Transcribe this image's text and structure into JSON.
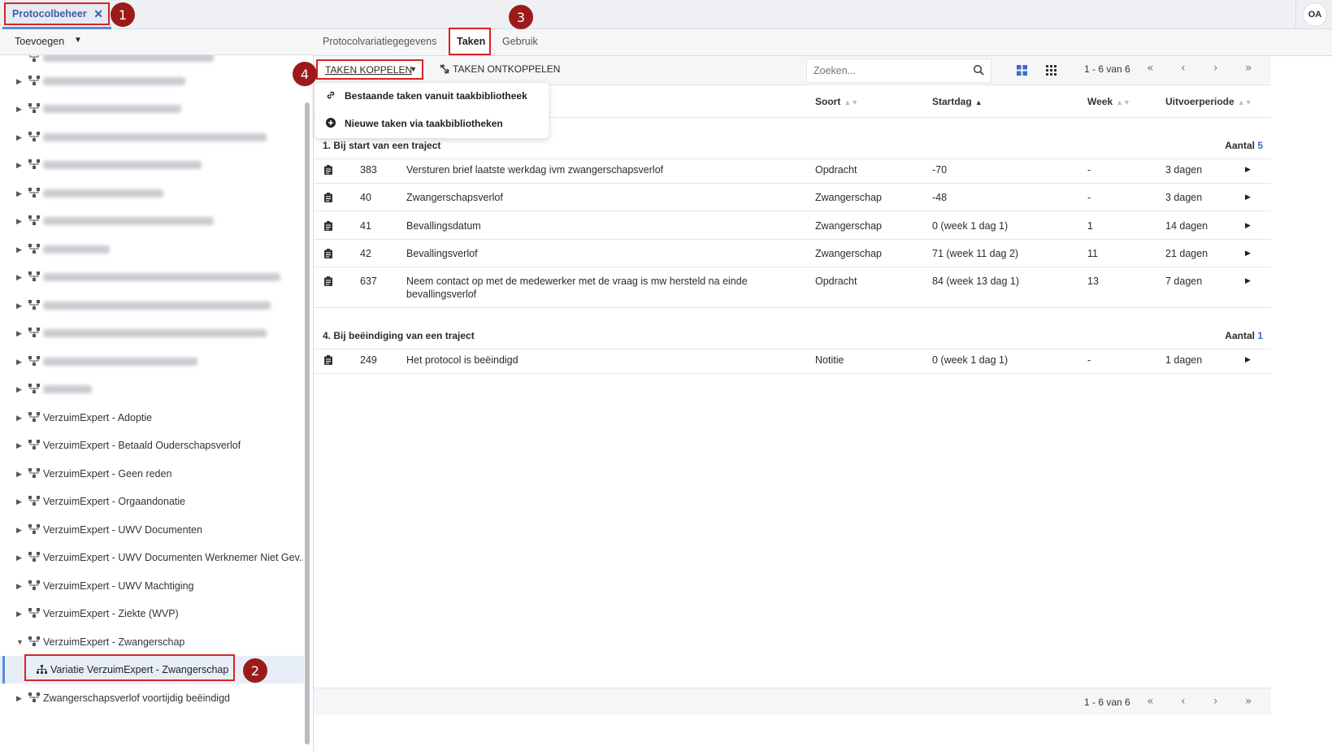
{
  "app_tab": {
    "label": "Protocolbeheer",
    "close": "✕"
  },
  "markers": [
    "1",
    "2",
    "3",
    "4"
  ],
  "user": {
    "initials": "OA"
  },
  "left": {
    "add_label": "Toevoegen",
    "tree": [
      {
        "label": "VerzuimExpert - Adoptie"
      },
      {
        "label": "VerzuimExpert - Betaald Ouderschapsverlof"
      },
      {
        "label": "VerzuimExpert - Geen reden"
      },
      {
        "label": "VerzuimExpert - Orgaandonatie"
      },
      {
        "label": "VerzuimExpert - UWV Documenten"
      },
      {
        "label": "VerzuimExpert - UWV Documenten Werknemer Niet Gev..."
      },
      {
        "label": "VerzuimExpert - UWV Machtiging"
      },
      {
        "label": "VerzuimExpert - Ziekte (WVP)"
      },
      {
        "label": "VerzuimExpert - Zwangerschap"
      },
      {
        "label": "Variatie VerzuimExpert - Zwangerschap"
      },
      {
        "label": "Zwangerschapsverlof voortijdig beëindigd"
      }
    ]
  },
  "tabs": {
    "gegevens": "Protocolvariatiegegevens",
    "taken": "Taken",
    "gebruik": "Gebruik"
  },
  "toolbar": {
    "koppelen": "TAKEN KOPPELEN",
    "ontkoppelen": "TAKEN ONTKOPPELEN",
    "search_placeholder": "Zoeken...",
    "pager": "1 - 6 van 6"
  },
  "dropdown": {
    "existing": "Bestaande taken vanuit taakbibliotheek",
    "new": "Nieuwe taken via taakbibliotheken"
  },
  "columns": {
    "soort": "Soort",
    "startdag": "Startdag",
    "week": "Week",
    "uitvoerperiode": "Uitvoerperiode"
  },
  "groups": [
    {
      "title": "1. Bij start van een traject",
      "count_label": "Aantal",
      "count": "5",
      "rows": [
        {
          "id": "383",
          "name": "Versturen brief laatste werkdag ivm zwangerschapsverlof",
          "soort": "Opdracht",
          "startdag": "-70",
          "week": "-",
          "periode": "3 dagen"
        },
        {
          "id": "40",
          "name": "Zwangerschapsverlof",
          "soort": "Zwangerschap",
          "startdag": "-48",
          "week": "-",
          "periode": "3 dagen"
        },
        {
          "id": "41",
          "name": "Bevallingsdatum",
          "soort": "Zwangerschap",
          "startdag": "0 (week 1 dag 1)",
          "week": "1",
          "periode": "14 dagen"
        },
        {
          "id": "42",
          "name": "Bevallingsverlof",
          "soort": "Zwangerschap",
          "startdag": "71 (week 11 dag 2)",
          "week": "11",
          "periode": "21 dagen"
        },
        {
          "id": "637",
          "name": "Neem contact op met de medewerker met de vraag is mw hersteld na einde bevallingsverlof",
          "soort": "Opdracht",
          "startdag": "84 (week 13 dag 1)",
          "week": "13",
          "periode": "7 dagen"
        }
      ]
    },
    {
      "title": "4. Bij beëindiging van een traject",
      "count_label": "Aantal",
      "count": "1",
      "rows": [
        {
          "id": "249",
          "name": "Het protocol is beëindigd",
          "soort": "Notitie",
          "startdag": "0 (week 1 dag 1)",
          "week": "-",
          "periode": "1 dagen"
        }
      ]
    }
  ],
  "footer": {
    "pager": "1 - 6 van 6"
  },
  "icons": {
    "close": "close-icon",
    "caret": "caret-down-icon",
    "tree_node": "hierarchy-icon",
    "variation": "sitemap-icon",
    "link": "link-icon",
    "unlink": "unlink-icon",
    "plus": "plus-circle-icon",
    "search": "search-icon",
    "view_large": "grid-large-icon",
    "view_small": "grid-small-icon",
    "clipboard": "clipboard-icon",
    "row_arrow": "caret-right-icon"
  },
  "colors": {
    "accent": "#3b6bd0",
    "highlight": "#d92323",
    "marker": "#9b1b1b",
    "selected_bg": "#e8eef8"
  }
}
